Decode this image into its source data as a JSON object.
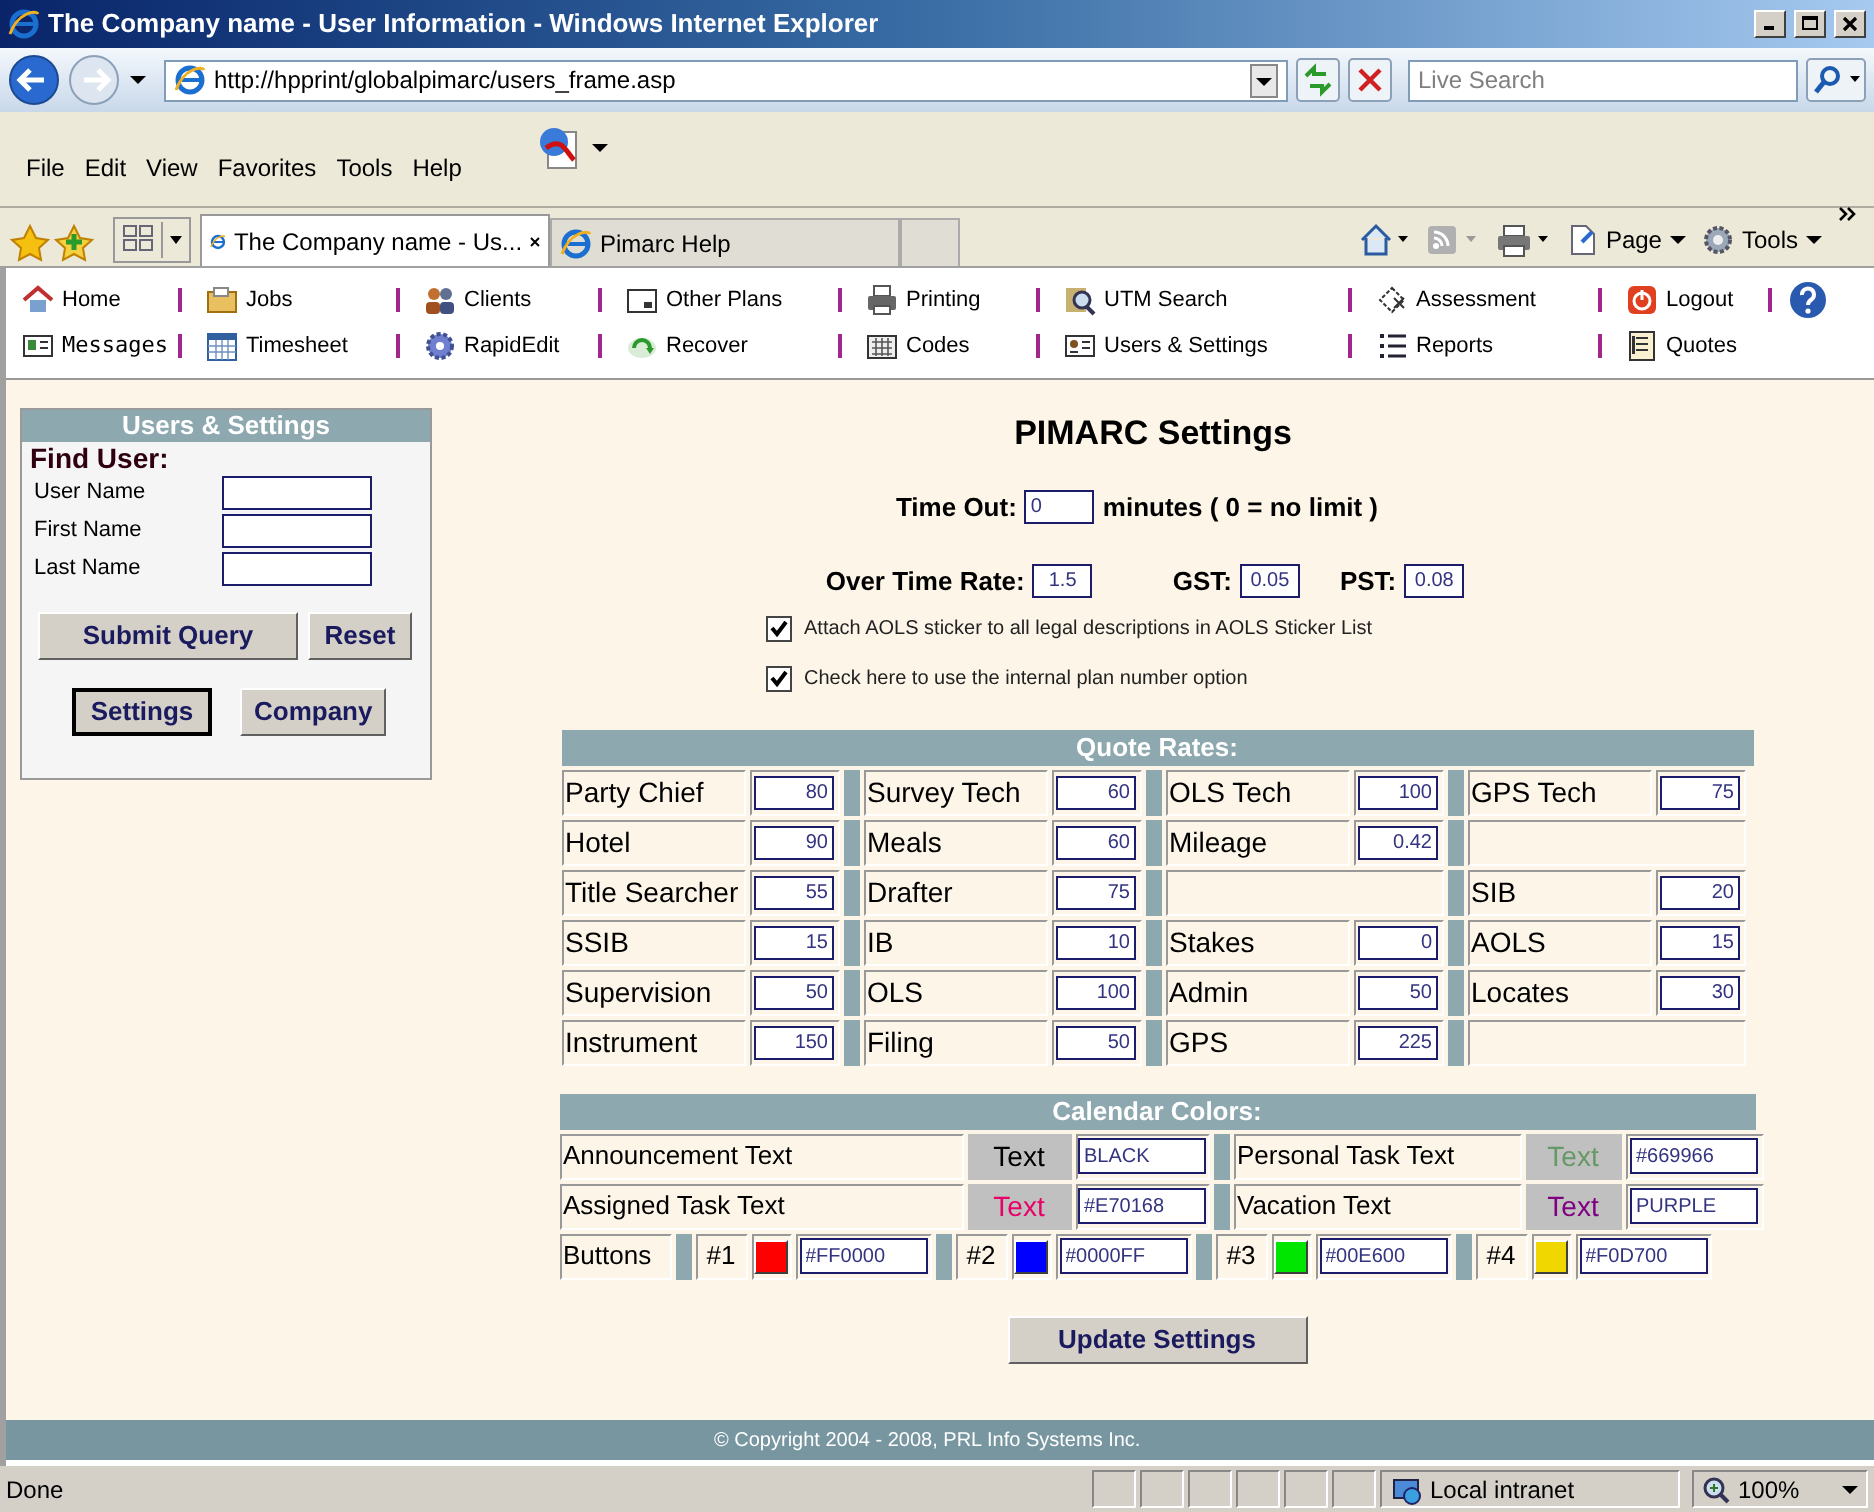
{
  "window": {
    "title": "The Company name - User Information - Windows Internet Explorer"
  },
  "address_bar": {
    "url": "http://hpprint/globalpimarc/users_frame.asp",
    "search_placeholder": "Live Search"
  },
  "menu": [
    "File",
    "Edit",
    "View",
    "Favorites",
    "Tools",
    "Help"
  ],
  "tabs": [
    {
      "label": "The Company name - Us...",
      "selected": true
    },
    {
      "label": "Pimarc Help",
      "selected": false
    }
  ],
  "command_bar": [
    "Page",
    "Tools"
  ],
  "nav": [
    [
      "Home",
      "Jobs",
      "Clients",
      "Other Plans",
      "Printing",
      "UTM Search",
      "Assessment",
      "Logout"
    ],
    [
      "Messages",
      "Timesheet",
      "RapidEdit",
      "Recover",
      "Codes",
      "Users & Settings",
      "Reports",
      "Quotes"
    ]
  ],
  "sidebar": {
    "title": "Users & Settings",
    "heading": "Find User:",
    "fields": [
      "User Name",
      "First Name",
      "Last Name"
    ],
    "buttons": [
      [
        {
          "label": "Submit Query",
          "selected": false
        },
        {
          "label": "Reset",
          "selected": false
        }
      ],
      [
        {
          "label": "Settings",
          "selected": true
        },
        {
          "label": "Company",
          "selected": false
        }
      ]
    ]
  },
  "settings": {
    "title": "PIMARC Settings",
    "timeout": {
      "label": "Time Out:",
      "value": "0",
      "suffix": "minutes ( 0 = no limit )"
    },
    "rates": [
      {
        "label": "Over Time Rate:",
        "value": "1.5"
      },
      {
        "label": "GST:",
        "value": "0.05"
      },
      {
        "label": "PST:",
        "value": "0.08"
      }
    ],
    "options": [
      {
        "label": "Attach AOLS sticker to all legal descriptions in AOLS Sticker List",
        "checked": true
      },
      {
        "label": "Check here to use the internal plan number option",
        "checked": true
      }
    ]
  },
  "quote_rates": {
    "title": "Quote Rates:",
    "rows": [
      [
        {
          "label": "Party Chief",
          "value": "80"
        },
        {
          "label": "Survey Tech",
          "value": "60"
        },
        {
          "label": "OLS Tech",
          "value": "100"
        },
        {
          "label": "GPS Tech",
          "value": "75"
        }
      ],
      [
        {
          "label": "Hotel",
          "value": "90"
        },
        {
          "label": "Meals",
          "value": "60"
        },
        {
          "label": "Mileage",
          "value": "0.42"
        },
        null
      ],
      [
        {
          "label": "Title Searcher",
          "value": "55"
        },
        {
          "label": "Drafter",
          "value": "75"
        },
        null,
        {
          "label": "SIB",
          "value": "20"
        }
      ],
      [
        {
          "label": "SSIB",
          "value": "15"
        },
        {
          "label": "IB",
          "value": "10"
        },
        {
          "label": "Stakes",
          "value": "0"
        },
        {
          "label": "AOLS",
          "value": "15"
        }
      ],
      [
        {
          "label": "Supervision",
          "value": "50"
        },
        {
          "label": "OLS",
          "value": "100"
        },
        {
          "label": "Admin",
          "value": "50"
        },
        {
          "label": "Locates",
          "value": "30"
        }
      ],
      [
        {
          "label": "Instrument",
          "value": "150"
        },
        {
          "label": "Filing",
          "value": "50"
        },
        {
          "label": "GPS",
          "value": "225"
        },
        null
      ]
    ]
  },
  "calendar_colors": {
    "title": "Calendar Colors:",
    "rows": [
      [
        {
          "label": "Announcement Text",
          "sample": "Text",
          "color": "#000000",
          "value": "BLACK"
        },
        {
          "label": "Personal Task Text",
          "sample": "Text",
          "color": "#669966",
          "value": "#669966"
        }
      ],
      [
        {
          "label": "Assigned Task Text",
          "sample": "Text",
          "color": "#e70168",
          "value": "#E70168"
        },
        {
          "label": "Vacation Text",
          "sample": "Text",
          "color": "#800080",
          "value": "PURPLE"
        }
      ]
    ],
    "buttons": {
      "label": "Buttons",
      "items": [
        {
          "number": "#1",
          "color": "#ff0000",
          "value": "#FF0000"
        },
        {
          "number": "#2",
          "color": "#0000ff",
          "value": "#0000FF"
        },
        {
          "number": "#3",
          "color": "#00e600",
          "value": "#00E600"
        },
        {
          "number": "#4",
          "color": "#f0d700",
          "value": "#F0D700"
        }
      ]
    }
  },
  "update_button": "Update Settings",
  "footer": "© Copyright 2004 - 2008, PRL Info Systems Inc.",
  "status_bar": {
    "text": "Done",
    "zone": "Local intranet",
    "zoom": "100%"
  }
}
